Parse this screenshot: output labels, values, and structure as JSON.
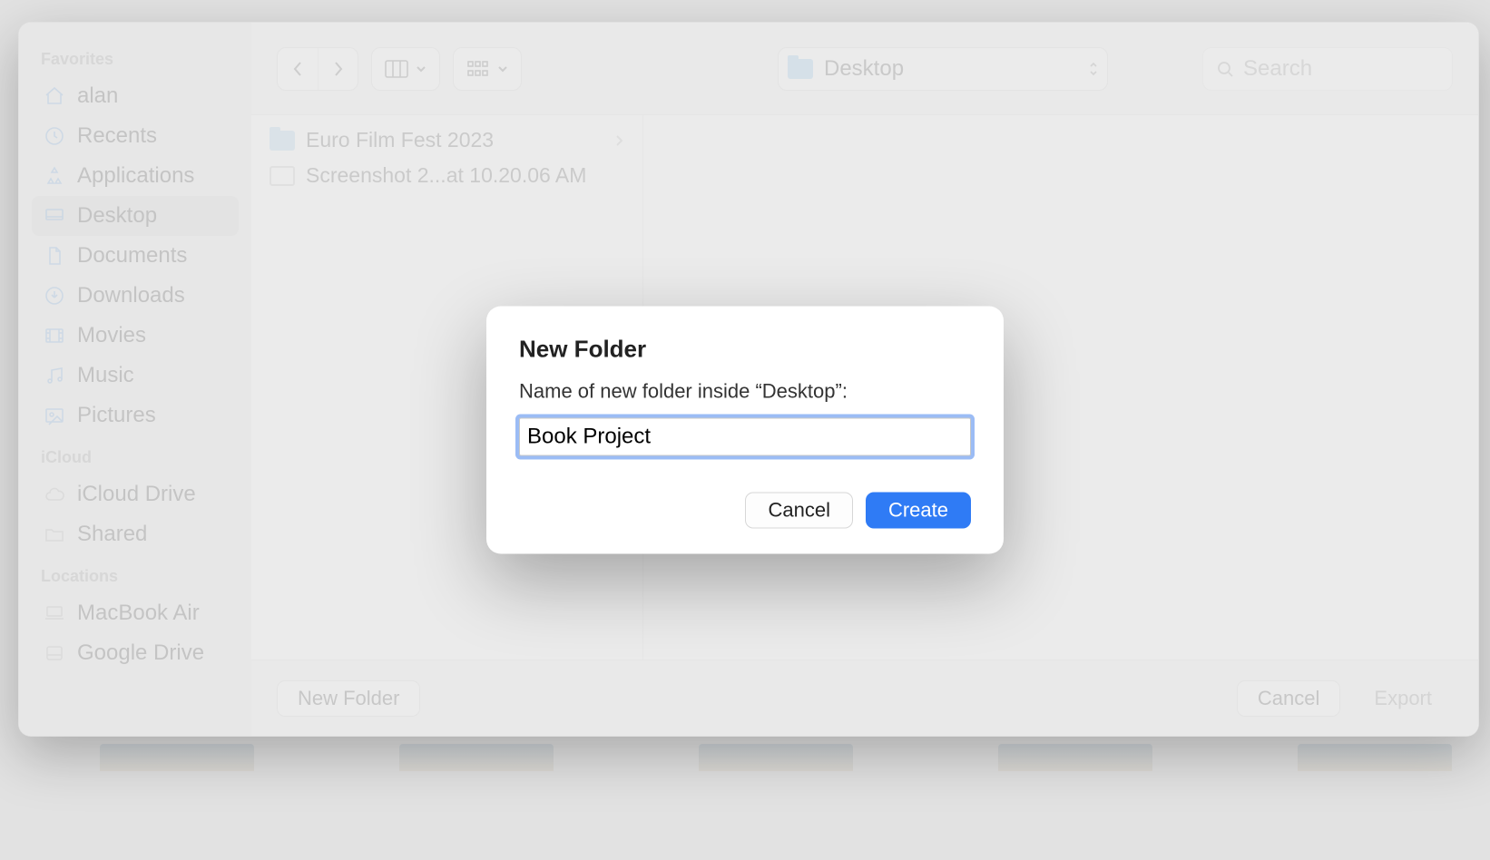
{
  "sidebar": {
    "sections": {
      "favorites": {
        "title": "Favorites",
        "items": [
          {
            "label": "alan",
            "icon": "home-icon"
          },
          {
            "label": "Recents",
            "icon": "clock-icon"
          },
          {
            "label": "Applications",
            "icon": "apps-icon"
          },
          {
            "label": "Desktop",
            "icon": "desktop-icon",
            "selected": true
          },
          {
            "label": "Documents",
            "icon": "document-icon"
          },
          {
            "label": "Downloads",
            "icon": "download-icon"
          },
          {
            "label": "Movies",
            "icon": "movie-icon"
          },
          {
            "label": "Music",
            "icon": "music-icon"
          },
          {
            "label": "Pictures",
            "icon": "pictures-icon"
          }
        ]
      },
      "icloud": {
        "title": "iCloud",
        "items": [
          {
            "label": "iCloud Drive",
            "icon": "cloud-icon"
          },
          {
            "label": "Shared",
            "icon": "shared-folder-icon"
          }
        ]
      },
      "locations": {
        "title": "Locations",
        "items": [
          {
            "label": "MacBook Air",
            "icon": "laptop-icon"
          },
          {
            "label": "Google Drive",
            "icon": "disk-icon"
          }
        ]
      }
    }
  },
  "toolbar": {
    "location_label": "Desktop",
    "search_placeholder": "Search"
  },
  "files": [
    {
      "name": "Euro Film Fest 2023",
      "kind": "folder",
      "has_children": true
    },
    {
      "name": "Screenshot 2...at 10.20.06 AM",
      "kind": "image",
      "has_children": false
    }
  ],
  "footer": {
    "new_folder_label": "New Folder",
    "cancel_label": "Cancel",
    "export_label": "Export"
  },
  "modal": {
    "title": "New Folder",
    "prompt": "Name of new folder inside “Desktop”:",
    "value": "Book Project",
    "cancel_label": "Cancel",
    "create_label": "Create"
  }
}
